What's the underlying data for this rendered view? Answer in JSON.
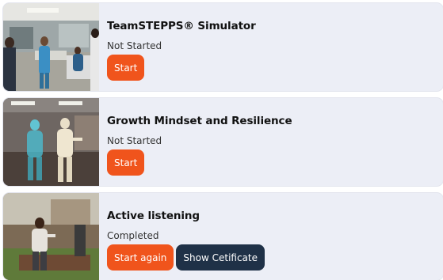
{
  "courses": [
    {
      "title": "TeamSTEPPS® Simulator",
      "status": "Not Started",
      "primary_button": "Start",
      "thumbnail_icon": "hospital-scene-thumbnail"
    },
    {
      "title": "Growth Mindset and Resilience",
      "status": "Not Started",
      "primary_button": "Start",
      "thumbnail_icon": "hologram-scene-thumbnail"
    },
    {
      "title": "Active listening",
      "status": "Completed",
      "primary_button": "Start again",
      "secondary_button": "Show Cetificate",
      "thumbnail_icon": "courtyard-scene-thumbnail"
    }
  ],
  "colors": {
    "card_background": "#eceef6",
    "start_button": "#f0541c",
    "certificate_button": "#1f3147"
  }
}
